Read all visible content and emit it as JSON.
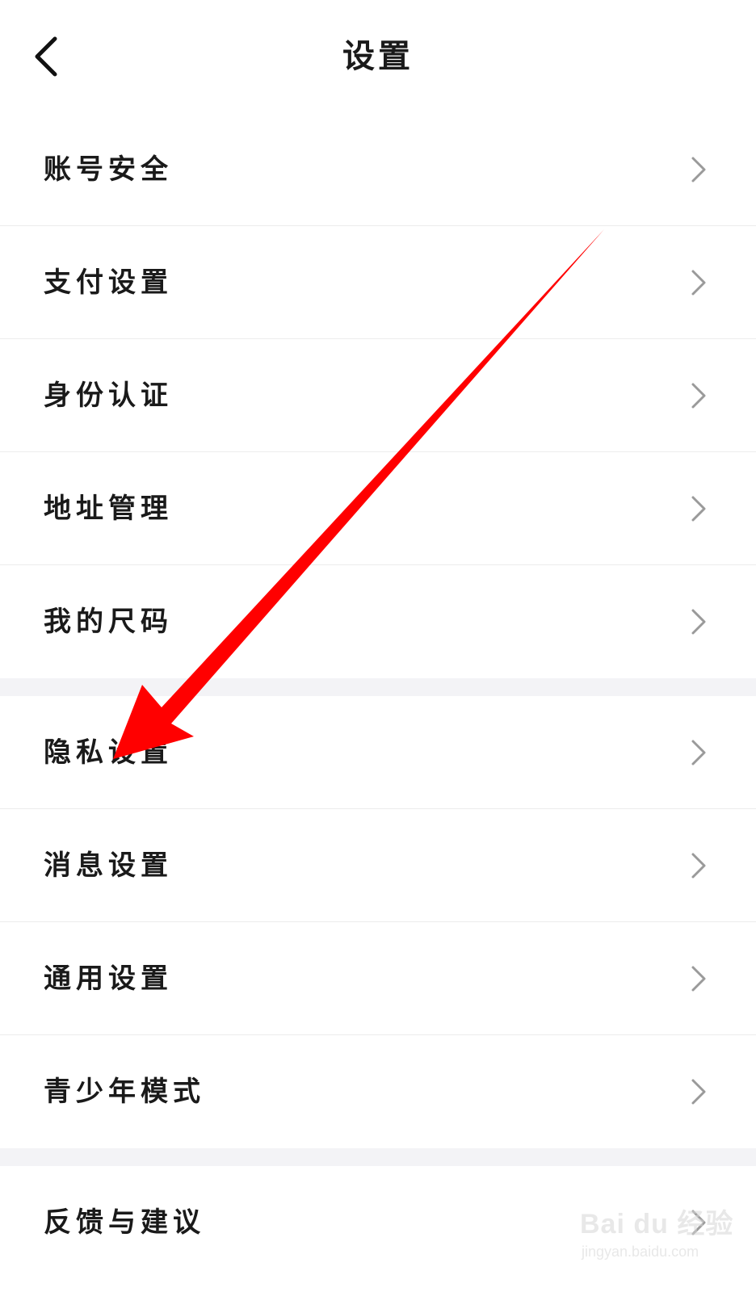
{
  "header": {
    "title": "设置",
    "back_icon": "chevron-left-icon"
  },
  "groups": [
    {
      "items": [
        {
          "label": "账号安全",
          "icon": "chevron-right-icon"
        },
        {
          "label": "支付设置",
          "icon": "chevron-right-icon"
        },
        {
          "label": "身份认证",
          "icon": "chevron-right-icon"
        },
        {
          "label": "地址管理",
          "icon": "chevron-right-icon"
        },
        {
          "label": "我的尺码",
          "icon": "chevron-right-icon"
        }
      ]
    },
    {
      "items": [
        {
          "label": "隐私设置",
          "icon": "chevron-right-icon"
        },
        {
          "label": "消息设置",
          "icon": "chevron-right-icon"
        },
        {
          "label": "通用设置",
          "icon": "chevron-right-icon"
        },
        {
          "label": "青少年模式",
          "icon": "chevron-right-icon"
        }
      ]
    },
    {
      "items": [
        {
          "label": "反馈与建议",
          "icon": "chevron-right-icon"
        }
      ]
    }
  ],
  "watermark": {
    "brand": "Bai du 经验",
    "url": "jingyan.baidu.com"
  },
  "colors": {
    "annotation_arrow": "#ff0000",
    "section_gap": "#f3f3f6",
    "chevron": "#9a9a9a"
  }
}
